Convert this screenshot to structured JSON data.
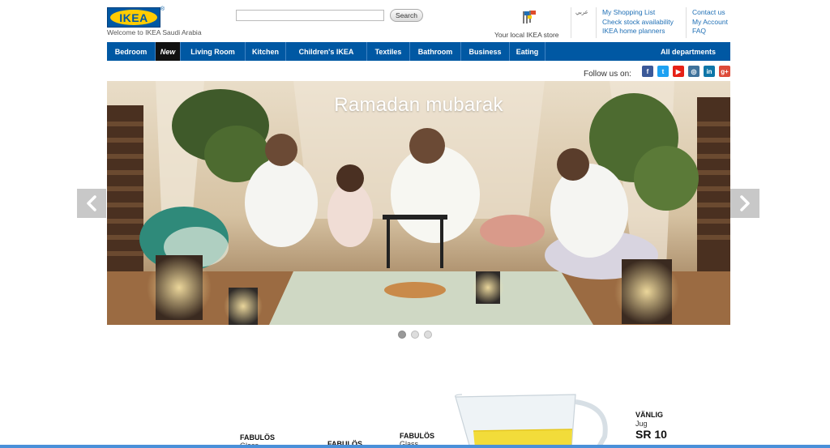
{
  "header": {
    "logo_text": "IKEA",
    "logo_reg": "®",
    "welcome": "Welcome to IKEA Saudi Arabia",
    "search_placeholder": "",
    "search_label": "Search",
    "store_label": "Your local IKEA store",
    "language_link": "عربي",
    "links_col1": [
      "My Shopping List",
      "Check stock availability",
      "IKEA home planners"
    ],
    "links_col2": [
      "Contact us",
      "My Account",
      "FAQ"
    ]
  },
  "nav": {
    "items": [
      "Bedroom",
      "New",
      "Living Room",
      "Kitchen",
      "Children's IKEA",
      "Textiles",
      "Bathroom",
      "Business",
      "Eating"
    ],
    "all_departments": "All departments"
  },
  "follow": {
    "label": "Follow us on:",
    "icons": [
      {
        "name": "facebook-icon",
        "glyph": "f",
        "color": "#3b5998"
      },
      {
        "name": "twitter-icon",
        "glyph": "t",
        "color": "#1da1f2"
      },
      {
        "name": "youtube-icon",
        "glyph": "▶",
        "color": "#e62117"
      },
      {
        "name": "instagram-icon",
        "glyph": "◎",
        "color": "#3f729b"
      },
      {
        "name": "linkedin-icon",
        "glyph": "in",
        "color": "#0e76a8"
      },
      {
        "name": "googleplus-icon",
        "glyph": "g+",
        "color": "#dd4b39"
      }
    ]
  },
  "hero": {
    "title": "Ramadan mubarak",
    "prev_icon": "chevron-left-icon",
    "next_icon": "chevron-right-icon",
    "slide_count": 3,
    "active_slide": 1
  },
  "products": [
    {
      "name": "FABULÖS",
      "type": "Glass"
    },
    {
      "name": "FABULÖS",
      "type": ""
    },
    {
      "name": "FABULÖS",
      "type": "Glass"
    }
  ],
  "featured": {
    "name": "VÄNLIG",
    "type": "Jug",
    "price": "SR 10"
  },
  "colors": {
    "brand_blue": "#0058a3",
    "brand_yellow": "#ffcc00",
    "link_blue": "#1f6fb5"
  }
}
